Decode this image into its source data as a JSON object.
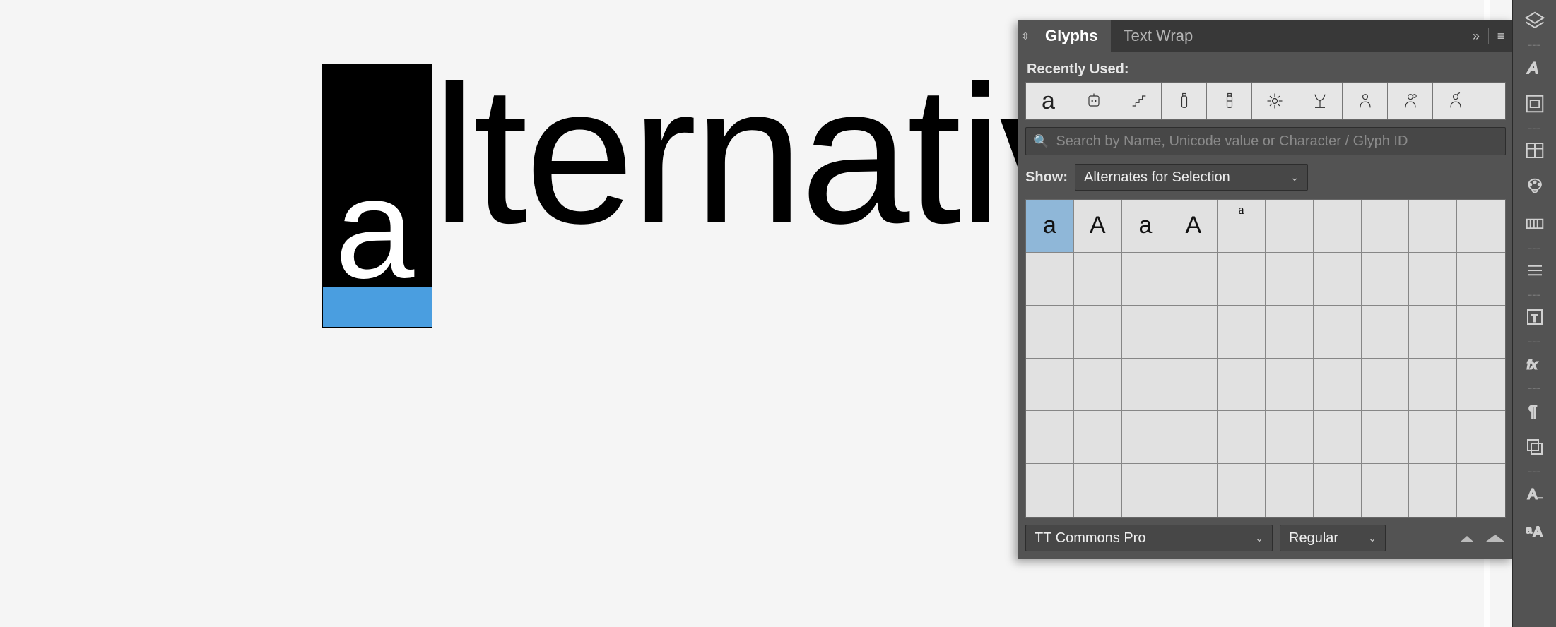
{
  "canvas": {
    "text_object": "lternativ",
    "selected_char": "a"
  },
  "panel": {
    "tabs": {
      "glyphs": "Glyphs",
      "text_wrap": "Text Wrap"
    },
    "recently_used_label": "Recently Used:",
    "recent": [
      {
        "glyph": "a"
      },
      {
        "icon": "robot-icon"
      },
      {
        "icon": "stairs-icon"
      },
      {
        "icon": "bottle-icon"
      },
      {
        "icon": "bottle2-icon"
      },
      {
        "icon": "burst-icon"
      },
      {
        "icon": "plant-icon"
      },
      {
        "icon": "person-icon"
      },
      {
        "icon": "person2-icon"
      },
      {
        "icon": "person3-icon"
      }
    ],
    "search_placeholder": "Search by Name, Unicode value or Character / Glyph ID",
    "show_label": "Show:",
    "show_value": "Alternates for Selection",
    "glyph_alternates": [
      "a",
      "A",
      "a",
      "A",
      "a"
    ],
    "grid_cols": 10,
    "grid_rows": 6,
    "font_family": "TT Commons Pro",
    "font_style": "Regular"
  },
  "dock": {
    "tools": [
      "layers-icon",
      "character-a-icon",
      "wrap-icon",
      "tables-icon",
      "swatches-icon",
      "gradient-icon",
      "lines-icon",
      "text-frame-icon",
      "fx-icon",
      "paragraph-icon",
      "object-states-icon",
      "char-style-icon",
      "para-style-icon"
    ]
  }
}
